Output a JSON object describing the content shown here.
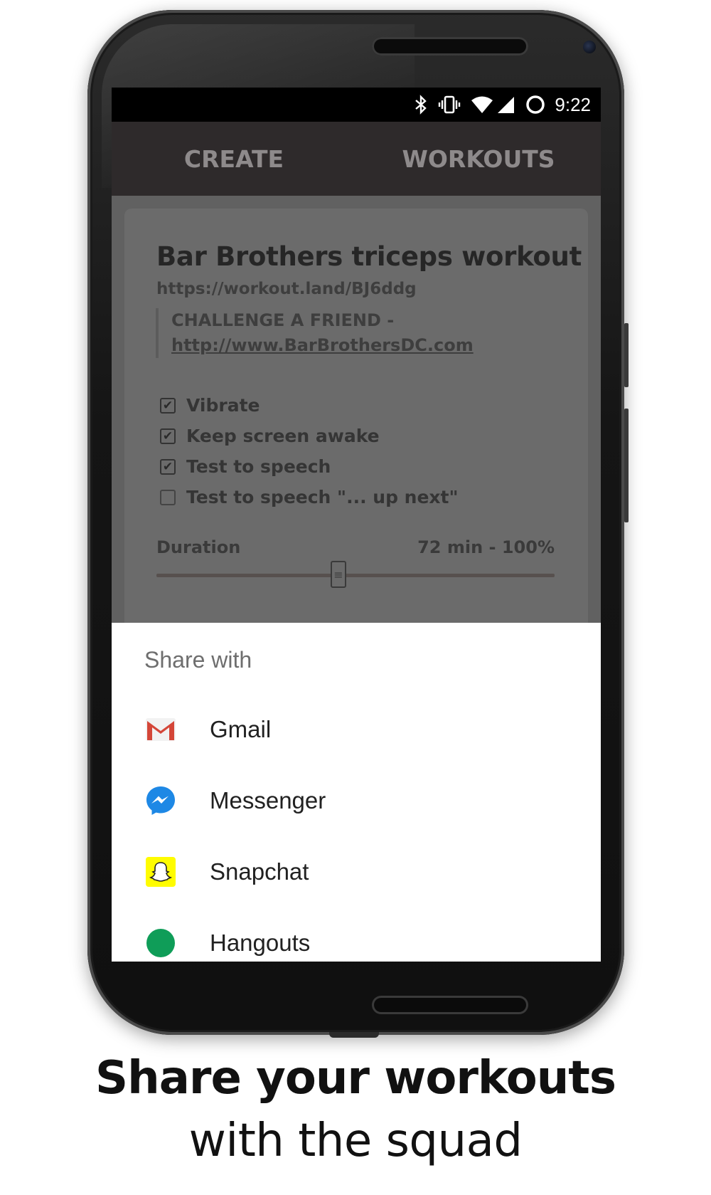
{
  "status_bar": {
    "time": "9:22",
    "icons": [
      "bluetooth-icon",
      "vibrate-icon",
      "wifi-icon",
      "signal-icon",
      "sync-icon"
    ]
  },
  "tabs": [
    {
      "label": "CREATE"
    },
    {
      "label": "WORKOUTS"
    }
  ],
  "workout": {
    "title": "Bar Brothers triceps workout",
    "url": "https://workout.land/BJ6ddg",
    "description_prefix": "CHALLENGE A FRIEND -",
    "description_link": "http://www.BarBrothersDC.com"
  },
  "options": [
    {
      "label": "Vibrate",
      "checked": true
    },
    {
      "label": "Keep screen awake",
      "checked": true
    },
    {
      "label": "Test to speech",
      "checked": true
    },
    {
      "label": "Test to speech \"... up next\"",
      "checked": false
    }
  ],
  "duration": {
    "label": "Duration",
    "value_text": "72 min - 100%",
    "slider_fraction": 0.5
  },
  "share_sheet": {
    "title": "Share with",
    "apps": [
      {
        "name": "Gmail",
        "icon": "gmail-icon"
      },
      {
        "name": "Messenger",
        "icon": "messenger-icon"
      },
      {
        "name": "Snapchat",
        "icon": "snapchat-icon"
      },
      {
        "name": "Hangouts",
        "icon": "hangouts-icon"
      }
    ]
  },
  "caption": {
    "line1": "Share your workouts",
    "line2": "with the squad"
  },
  "colors": {
    "tab_bar": "#2e2a2b",
    "overlay_content": "#616161",
    "gmail_red": "#d44638",
    "messenger_blue": "#1e88e5",
    "snapchat_yellow": "#fffc00",
    "hangouts_green": "#0f9d58"
  }
}
